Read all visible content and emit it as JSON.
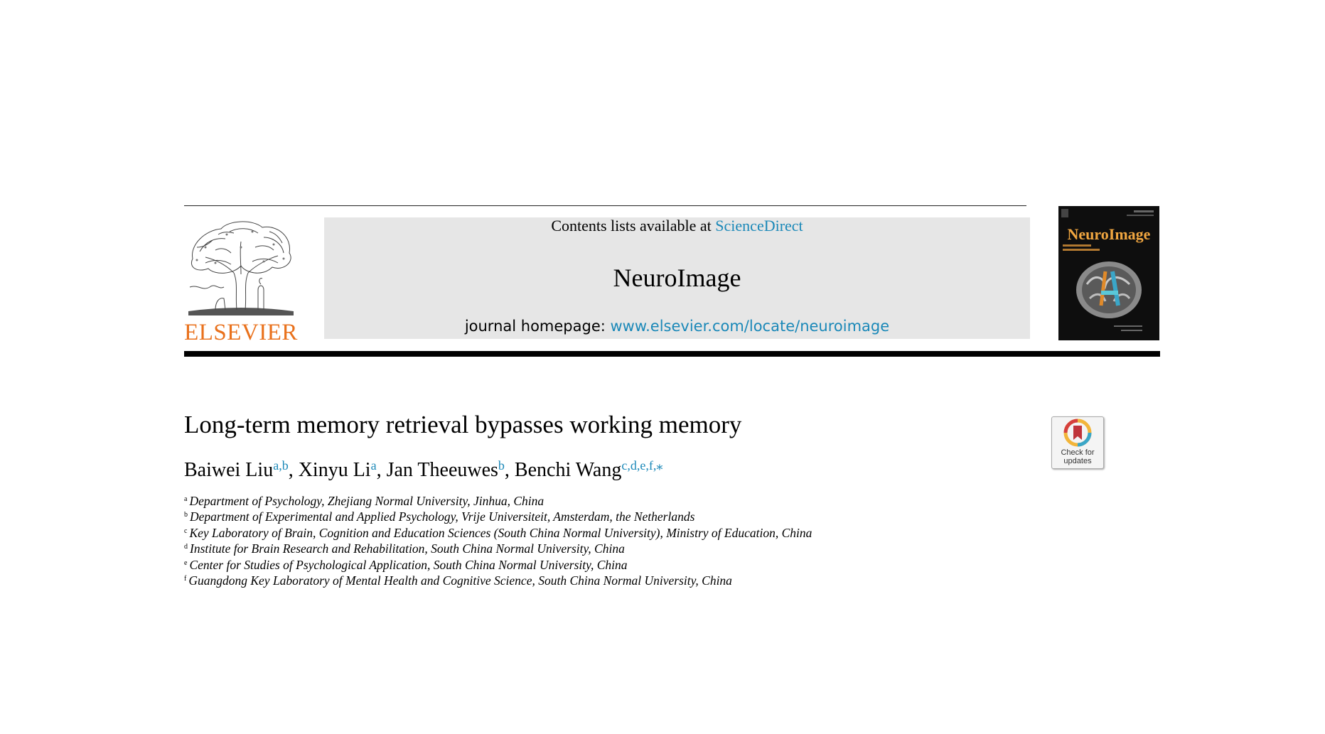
{
  "header": {
    "contents_prefix": "Contents lists available at ",
    "contents_link": "ScienceDirect",
    "journal_name": "NeuroImage",
    "homepage_prefix": "journal homepage: ",
    "homepage_link": "www.elsevier.com/locate/neuroimage",
    "publisher": "ELSEVIER",
    "cover_title": "NeuroImage"
  },
  "article": {
    "title": "Long-term memory retrieval bypasses working memory",
    "authors": [
      {
        "name": "Baiwei Liu",
        "sup": "a,b",
        "sep": ", "
      },
      {
        "name": "Xinyu Li",
        "sup": "a",
        "sep": ", "
      },
      {
        "name": "Jan Theeuwes",
        "sup": "b",
        "sep": ", "
      },
      {
        "name": "Benchi Wang",
        "sup": "c,d,e,f,⁎",
        "sep": ""
      }
    ],
    "affiliations": [
      {
        "key": "a",
        "text": "Department of Psychology, Zhejiang Normal University, Jinhua, China"
      },
      {
        "key": "b",
        "text": "Department of Experimental and Applied Psychology, Vrije Universiteit, Amsterdam, the Netherlands"
      },
      {
        "key": "c",
        "text": "Key Laboratory of Brain, Cognition and Education Sciences (South China Normal University), Ministry of Education, China"
      },
      {
        "key": "d",
        "text": "Institute for Brain Research and Rehabilitation, South China Normal University, China"
      },
      {
        "key": "e",
        "text": "Center for Studies of Psychological Application, South China Normal University, China"
      },
      {
        "key": "f",
        "text": "Guangdong Key Laboratory of Mental Health and Cognitive Science, South China Normal University, China"
      }
    ]
  },
  "badge": {
    "line1": "Check for",
    "line2": "updates"
  },
  "colors": {
    "link": "#1a88b8",
    "publisher_orange": "#e9711c",
    "cover_title": "#f0a640"
  },
  "icons": [
    "elsevier-tree-logo",
    "journal-cover-brain-image",
    "crossmark-bookmark-icon"
  ]
}
